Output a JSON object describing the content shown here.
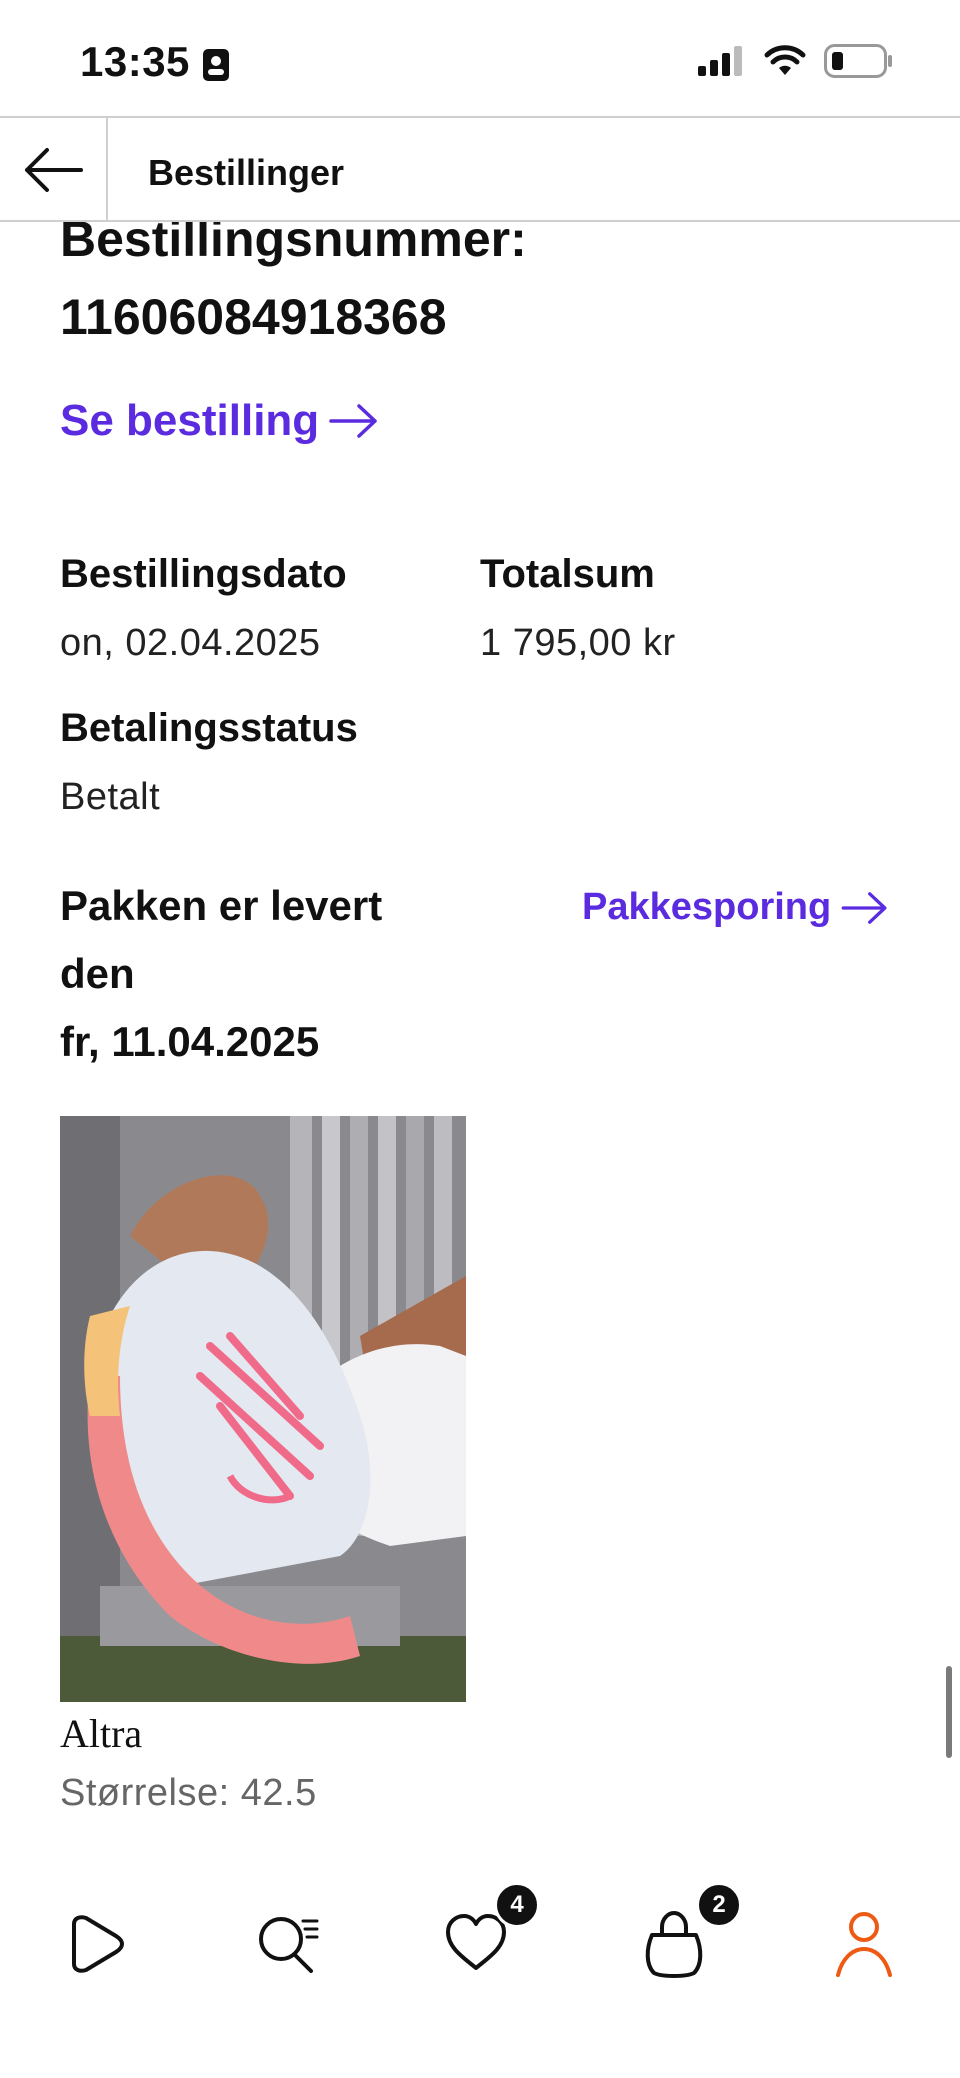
{
  "status_bar": {
    "time": "13:35",
    "icons": [
      "id-badge-icon",
      "cellular-signal-icon",
      "wifi-icon",
      "battery-icon"
    ]
  },
  "header": {
    "title": "Bestillinger",
    "back_icon": "arrow-left-icon"
  },
  "order": {
    "number_label": "Bestillingsnummer:",
    "number": "11606084918368",
    "see_order_link": "Se bestilling",
    "order_date_label": "Bestillingsdato",
    "order_date": "on, 02.04.2025",
    "total_label": "Totalsum",
    "total": "1 795,00 kr",
    "payment_status_label": "Betalingsstatus",
    "payment_status": "Betalt",
    "delivery_status_line1": "Pakken er levert",
    "delivery_status_line2": "den",
    "delivery_date": "fr, 11.04.2025",
    "tracking_link": "Pakkesporing"
  },
  "product": {
    "brand": "Altra",
    "size": "Størrelse: 42.5"
  },
  "bottom_nav": {
    "items": [
      {
        "name": "home",
        "icon": "play-logo-icon"
      },
      {
        "name": "search",
        "icon": "search-list-icon"
      },
      {
        "name": "wishlist",
        "icon": "heart-icon",
        "badge": "4"
      },
      {
        "name": "cart",
        "icon": "shopping-bag-icon",
        "badge": "2"
      },
      {
        "name": "account",
        "icon": "person-icon",
        "active": true
      }
    ]
  },
  "colors": {
    "link": "#5b2be0",
    "active_nav": "#ee5a13",
    "text": "#111111",
    "muted": "#666666"
  }
}
